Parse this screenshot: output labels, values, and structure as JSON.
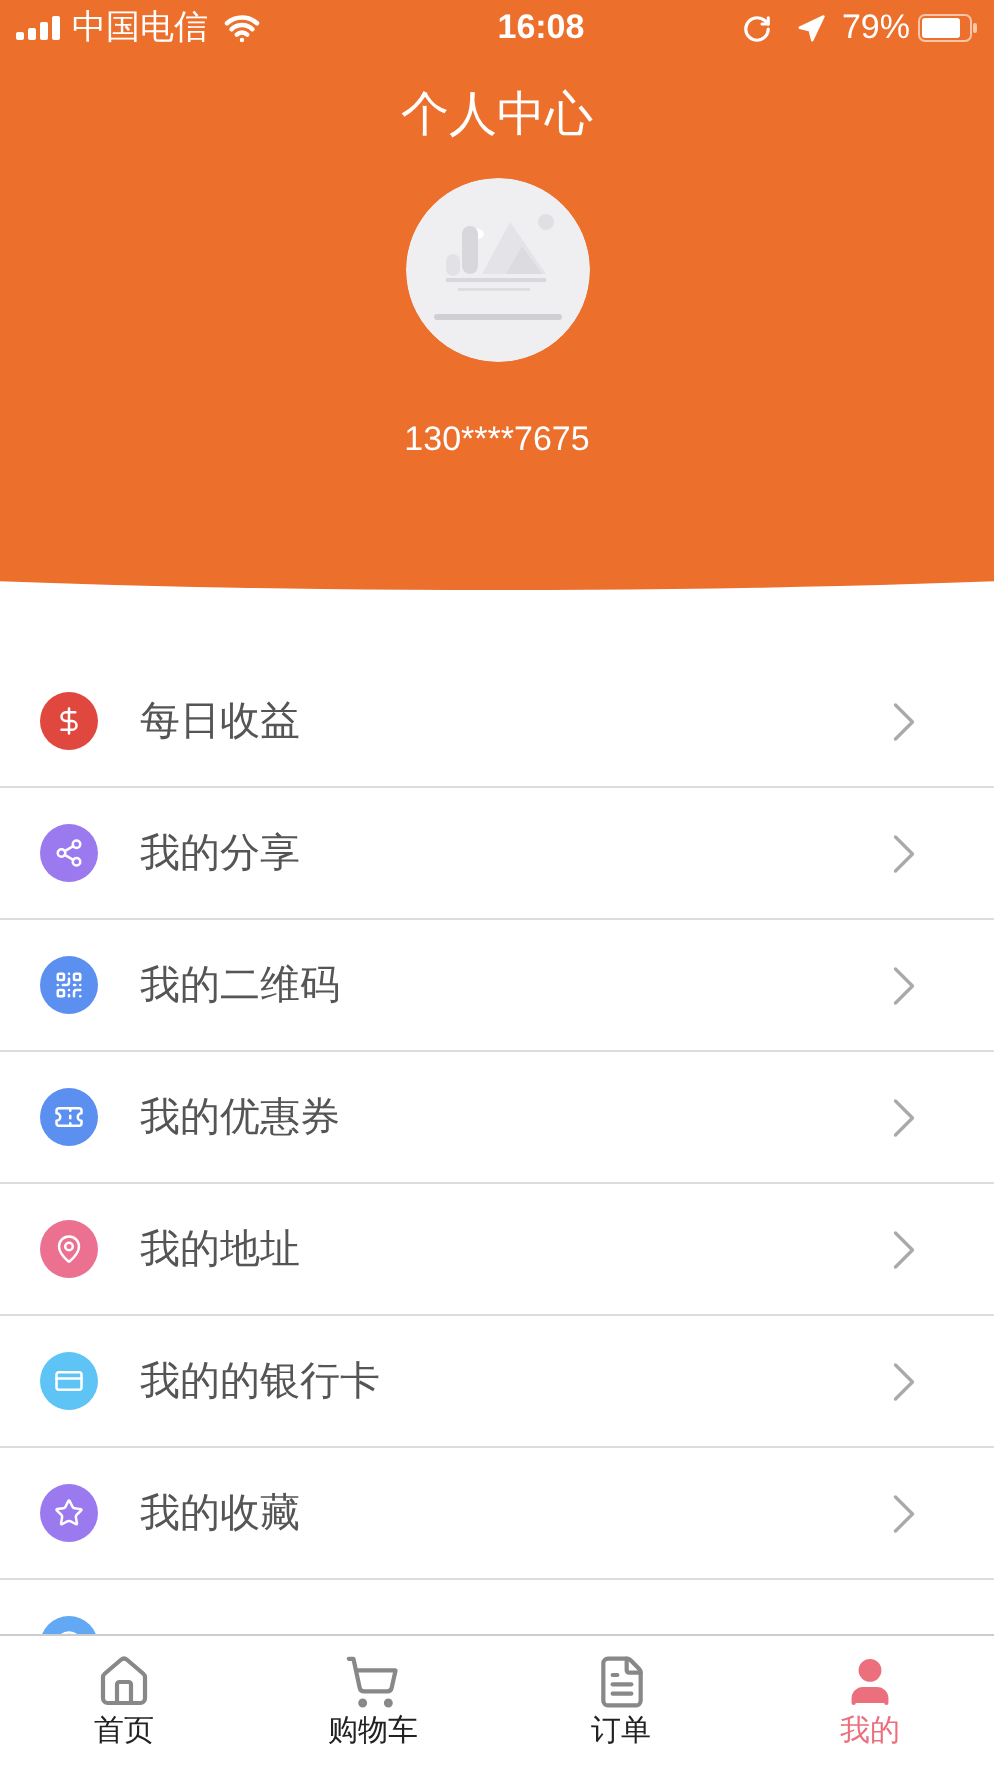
{
  "status_bar": {
    "carrier": "中国电信",
    "time": "16:08",
    "battery": "79%"
  },
  "header": {
    "title": "个人中心",
    "phone": "130****7675"
  },
  "menu": [
    {
      "label": "每日收益",
      "color": "#e0473f"
    },
    {
      "label": "我的分享",
      "color": "#9b7af0"
    },
    {
      "label": "我的二维码",
      "color": "#5b8ff0"
    },
    {
      "label": "我的优惠券",
      "color": "#5b8ff0"
    },
    {
      "label": "我的地址",
      "color": "#ec7090"
    },
    {
      "label": "我的的银行卡",
      "color": "#5ec3f5"
    },
    {
      "label": "我的收藏",
      "color": "#9b7af0"
    },
    {
      "color": "#62a8f5"
    }
  ],
  "tab_bar": [
    {
      "label": "首页",
      "selected": false
    },
    {
      "label": "购物车",
      "selected": false
    },
    {
      "label": "订单",
      "selected": false
    },
    {
      "label": "我的",
      "selected": true
    }
  ]
}
